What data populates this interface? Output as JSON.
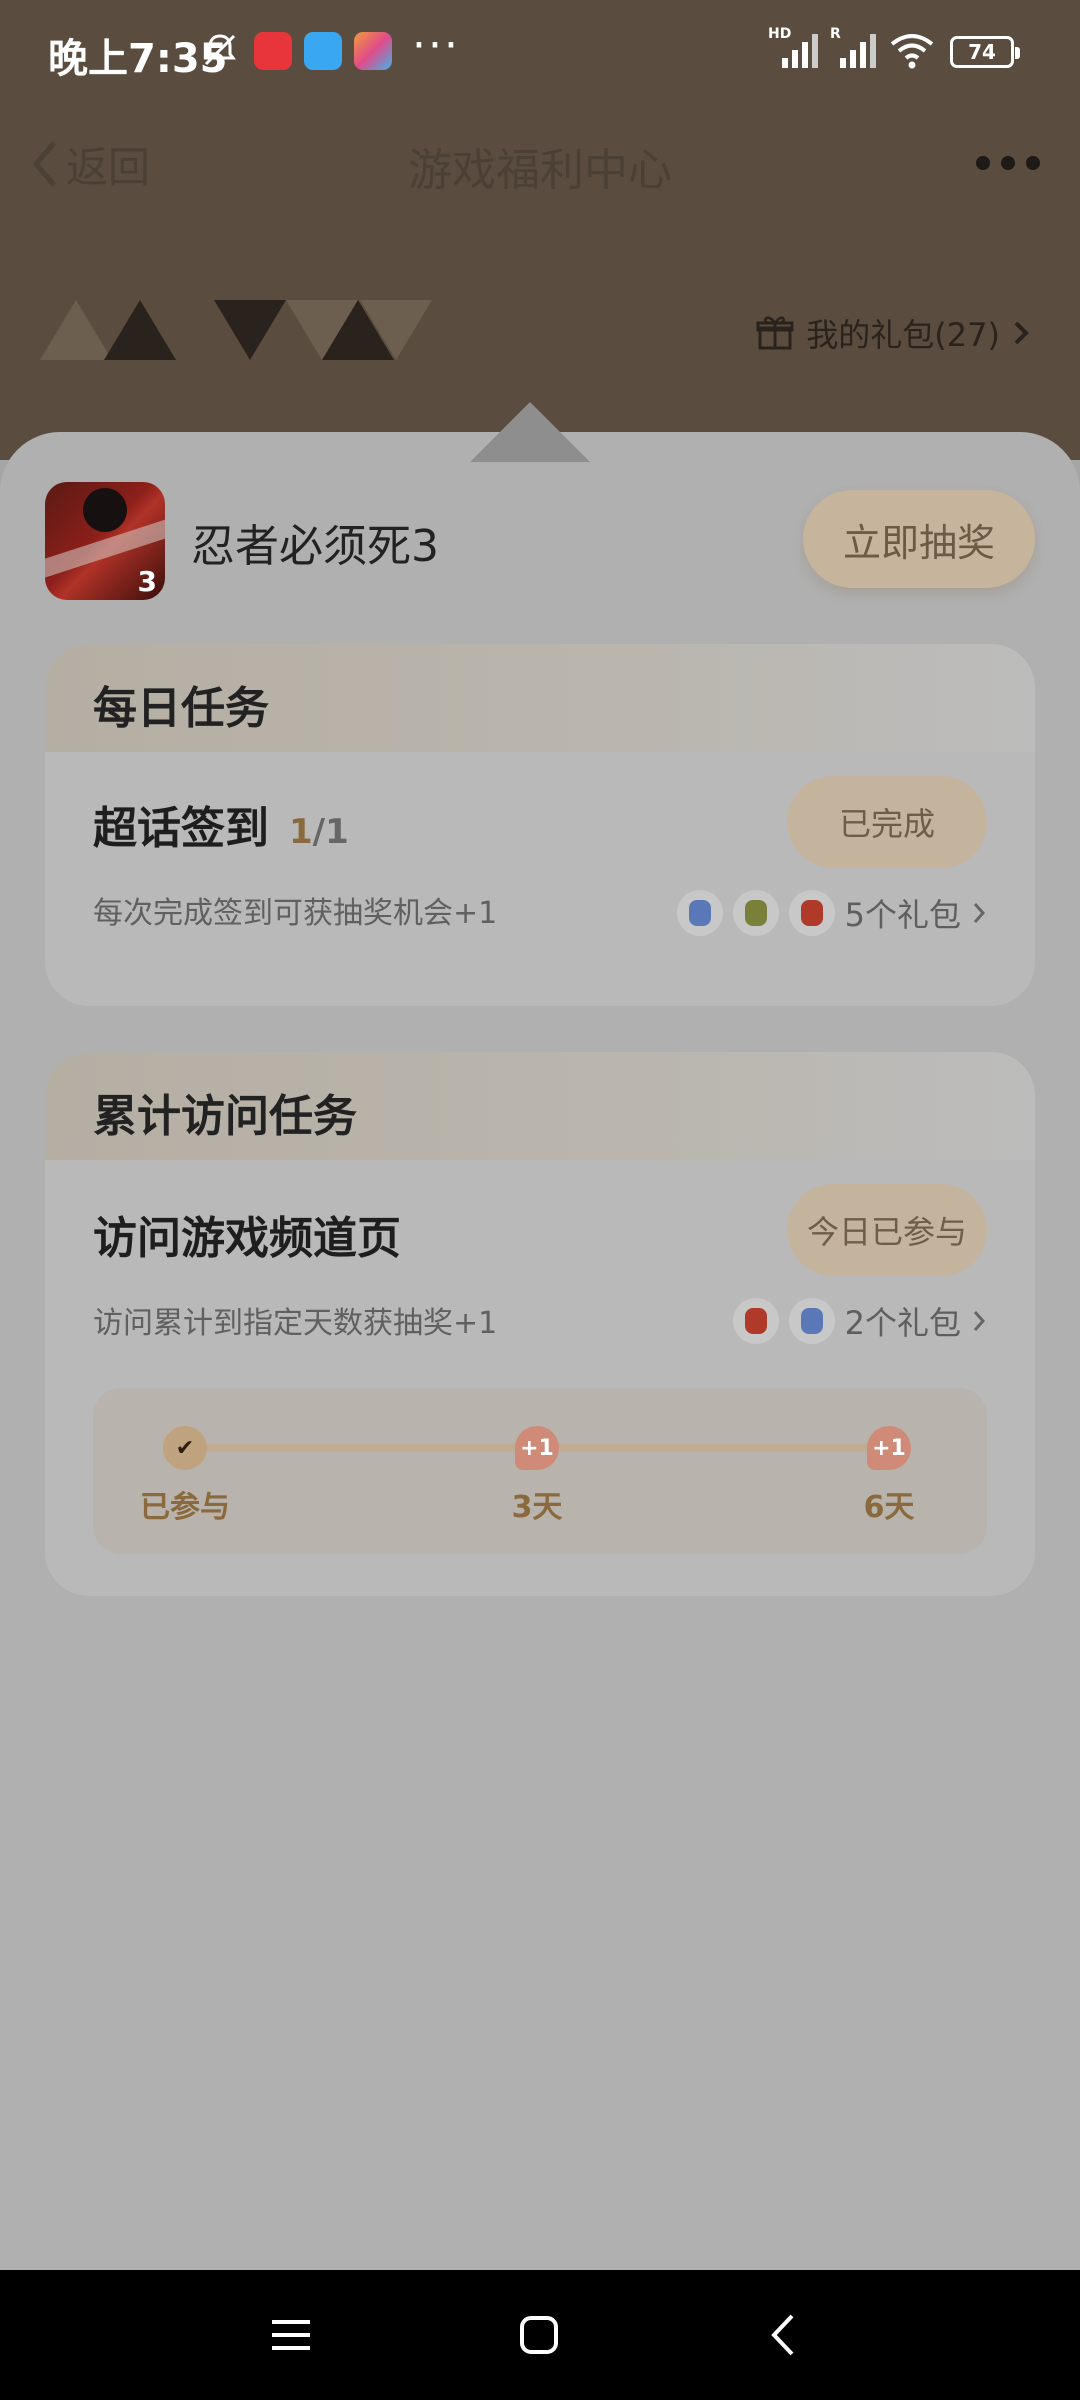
{
  "status": {
    "time": "晚上7:35",
    "dots": "···",
    "battery": "74",
    "signal1_tag": "HD",
    "signal2_tag": "R",
    "colors": {
      "app1": "#e8353b",
      "app2": "#3aa7f3",
      "app3": "#f39c3a"
    }
  },
  "nav": {
    "back_label": "返回",
    "title": "游戏福利中心",
    "gift_link": "我的礼包(27)"
  },
  "game": {
    "name": "忍者必须死3",
    "icon_badge": "3",
    "lottery_button": "立即抽奖"
  },
  "daily": {
    "title": "每日任务",
    "task_name": "超话签到",
    "done": "1",
    "total": "/1",
    "status_button": "已完成",
    "desc": "每次完成签到可获抽奖机会+1",
    "gifts_label": "5个礼包"
  },
  "visit": {
    "title": "累计访问任务",
    "task_name": "访问游戏频道页",
    "status_button": "今日已参与",
    "desc": "访问累计到指定天数获抽奖+1",
    "gifts_label": "2个礼包",
    "progress": [
      {
        "label": "已参与",
        "marker": "✔"
      },
      {
        "label": "3天",
        "marker": "+1"
      },
      {
        "label": "6天",
        "marker": "+1"
      }
    ]
  },
  "accent": "#8a6a3c"
}
